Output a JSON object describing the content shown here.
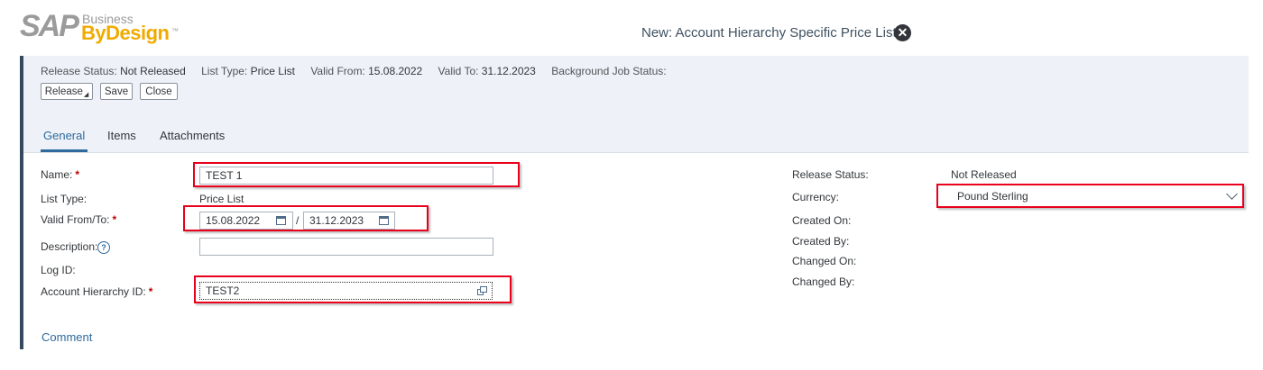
{
  "logo": {
    "sap": "SAP",
    "business": "Business",
    "bydesign": "ByDesign",
    "tm": "™"
  },
  "window": {
    "title": "New: Account Hierarchy Specific Price List"
  },
  "header": {
    "release_status_label": "Release Status:",
    "release_status_value": "Not Released",
    "list_type_label": "List Type:",
    "list_type_value": "Price List",
    "valid_from_label": "Valid From:",
    "valid_from_value": "15.08.2022",
    "valid_to_label": "Valid To:",
    "valid_to_value": "31.12.2023",
    "background_job_label": "Background Job Status:"
  },
  "toolbar": {
    "release_label": "Release",
    "save_label": "Save",
    "close_label": "Close"
  },
  "tabs": [
    {
      "label": "General",
      "active": true
    },
    {
      "label": "Items"
    },
    {
      "label": "Attachments"
    }
  ],
  "form_left": {
    "name_label": "Name:",
    "name_value": "TEST 1",
    "list_type_label": "List Type:",
    "list_type_value": "Price List",
    "valid_label": "Valid From/To:",
    "valid_from_value": "15.08.2022",
    "valid_separator": "/",
    "valid_to_value": "31.12.2023",
    "description_label": "Description:",
    "description_value": "",
    "log_id_label": "Log ID:",
    "account_hierarchy_label": "Account Hierarchy ID:",
    "account_hierarchy_value": "TEST2"
  },
  "form_right": {
    "release_status_label": "Release Status:",
    "release_status_value": "Not Released",
    "currency_label": "Currency:",
    "currency_value": "Pound Sterling",
    "created_on_label": "Created On:",
    "created_by_label": "Created By:",
    "changed_on_label": "Changed On:",
    "changed_by_label": "Changed By:"
  },
  "comment": {
    "label": "Comment"
  },
  "colors": {
    "accent": "#2e6a9e",
    "highlight": "#e8001c",
    "header_band": "#eef2f8",
    "logo_gold": "#f0ab00"
  },
  "icons": [
    "close-icon",
    "calendar-icon",
    "help-icon",
    "value-help-icon",
    "chevron-down-icon"
  ]
}
